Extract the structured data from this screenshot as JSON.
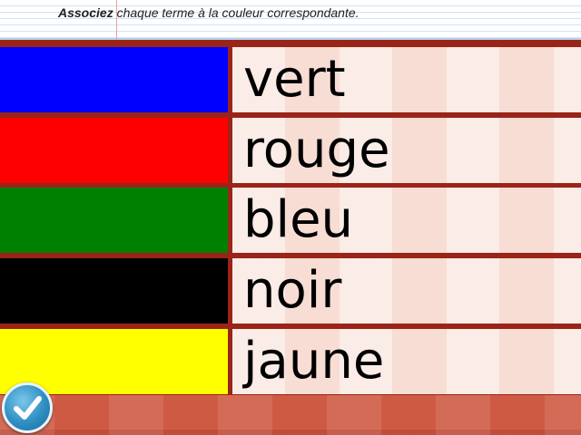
{
  "instruction": {
    "emphasis": "Associez",
    "rest": " chaque terme à la couleur correspondante."
  },
  "swatches": [
    {
      "color": "#0000ff"
    },
    {
      "color": "#ff0000"
    },
    {
      "color": "#008000"
    },
    {
      "color": "#000000"
    },
    {
      "color": "#ffff00"
    }
  ],
  "words": [
    "vert",
    "rouge",
    "bleu",
    "noir",
    "jaune"
  ],
  "check_button": {
    "icon": "checkmark-icon"
  }
}
